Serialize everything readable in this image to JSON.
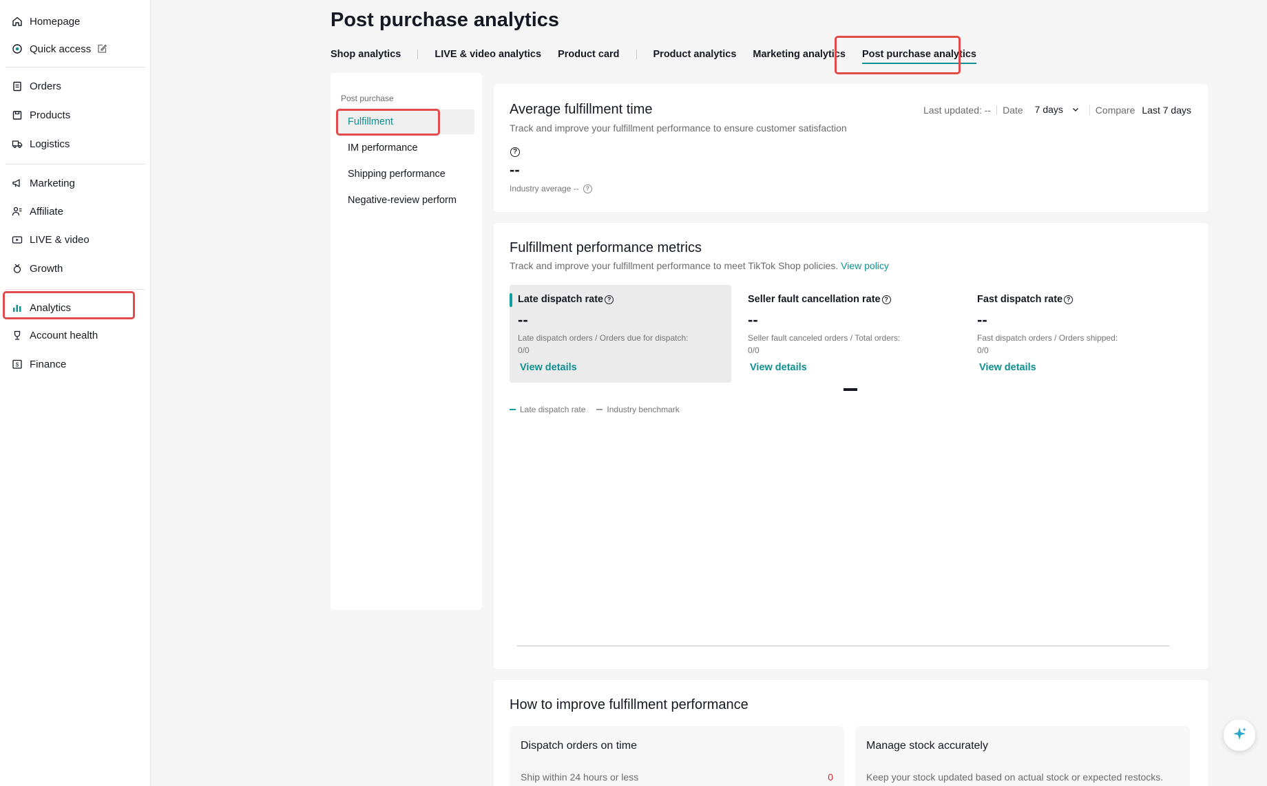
{
  "sidebar": {
    "items": [
      {
        "label": "Homepage",
        "icon": "home-icon"
      },
      {
        "label": "Quick access",
        "icon": "quick-access-icon"
      },
      {
        "label": "Orders",
        "icon": "orders-icon"
      },
      {
        "label": "Products",
        "icon": "products-icon"
      },
      {
        "label": "Logistics",
        "icon": "logistics-icon"
      },
      {
        "label": "Marketing",
        "icon": "megaphone-icon"
      },
      {
        "label": "Affiliate",
        "icon": "affiliate-icon"
      },
      {
        "label": "LIVE & video",
        "icon": "live-video-icon"
      },
      {
        "label": "Growth",
        "icon": "growth-icon"
      },
      {
        "label": "Analytics",
        "icon": "analytics-icon"
      },
      {
        "label": "Account health",
        "icon": "trophy-icon"
      },
      {
        "label": "Finance",
        "icon": "finance-icon"
      }
    ],
    "active": "Analytics"
  },
  "header": {
    "title": "Post purchase analytics",
    "tabs": [
      {
        "label": "Shop analytics"
      },
      {
        "label": "LIVE & video analytics"
      },
      {
        "label": "Product card"
      },
      {
        "label": "Product analytics"
      },
      {
        "label": "Marketing analytics"
      },
      {
        "label": "Post purchase analytics"
      }
    ],
    "active_tab": "Post purchase analytics"
  },
  "subnav": {
    "group": "Post purchase",
    "items": [
      {
        "label": "Fulfillment"
      },
      {
        "label": "IM performance"
      },
      {
        "label": "Shipping performance"
      },
      {
        "label": "Negative-review perform"
      }
    ],
    "active": "Fulfillment"
  },
  "avg_card": {
    "title": "Average fulfillment time",
    "subtitle": "Track and improve your fulfillment performance to ensure customer satisfaction",
    "value": "--",
    "industry_average": "Industry average --",
    "filters": {
      "last_updated": "Last updated: --",
      "date_label": "Date",
      "date_value": "7 days",
      "compare_label": "Compare",
      "compare_value": "Last 7 days"
    }
  },
  "metrics_card": {
    "title": "Fulfillment performance metrics",
    "subtitle": "Track and improve your fulfillment performance to meet TikTok Shop policies.",
    "policy_link": "View policy",
    "metrics": [
      {
        "label": "Late dispatch rate",
        "value": "--",
        "desc": "Late dispatch orders / Orders due for dispatch:",
        "ratio": "0/0",
        "link": "View details"
      },
      {
        "label": "Seller fault cancellation rate",
        "value": "--",
        "desc": "Seller fault canceled orders / Total orders:",
        "ratio": "0/0",
        "link": "View details"
      },
      {
        "label": "Fast dispatch rate",
        "value": "--",
        "desc": "Fast dispatch orders / Orders shipped:",
        "ratio": "0/0",
        "link": "View details"
      }
    ],
    "legend": [
      {
        "label": "Late dispatch rate",
        "style": "solid",
        "color": "#0f9d9d"
      },
      {
        "label": "Industry benchmark",
        "style": "dashed",
        "color": "#9a9a9a"
      }
    ]
  },
  "improve_card": {
    "title": "How to improve fulfillment performance",
    "tips": [
      {
        "title": "Dispatch orders on time",
        "text": "Ship within 24 hours or less",
        "count": "0"
      },
      {
        "title": "Manage stock accurately",
        "text": "Keep your stock updated based on actual stock or expected restocks.",
        "count": ""
      }
    ]
  },
  "colors": {
    "accent": "#0f8f8f",
    "highlight": "#e14b4b",
    "danger": "#c62828"
  }
}
